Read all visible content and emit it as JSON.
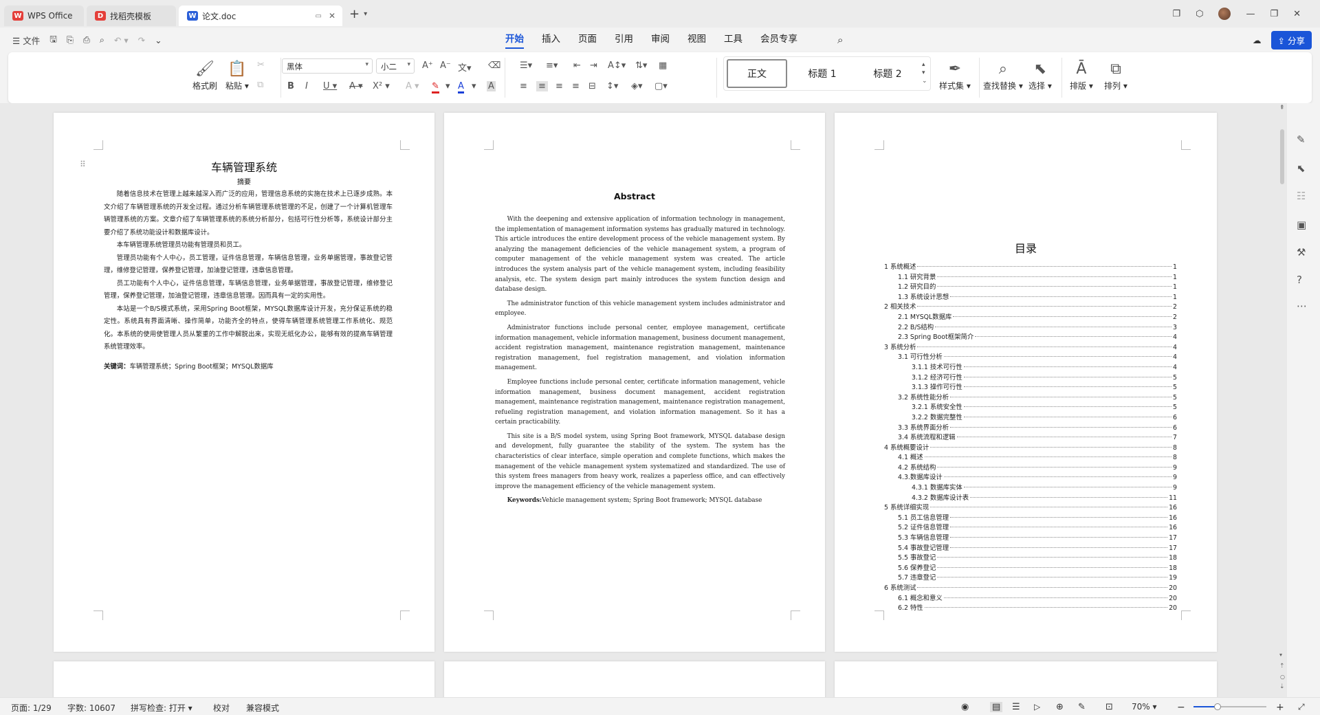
{
  "titlebar": {
    "tabs": [
      {
        "label": "WPS Office",
        "logo": "W",
        "color": "#e43f3a"
      },
      {
        "label": "找稻壳模板",
        "logo": "D",
        "color": "#e43f3a"
      },
      {
        "label": "论文.doc",
        "logo": "W",
        "color": "#2b5fd8"
      }
    ]
  },
  "menubar": {
    "file_label": "文件",
    "tabs": [
      "开始",
      "插入",
      "页面",
      "引用",
      "审阅",
      "视图",
      "工具",
      "会员专享"
    ],
    "active_tab": "开始",
    "share_label": "分享"
  },
  "ribbon": {
    "format_painter": "格式刷",
    "paste": "粘贴",
    "font_name": "黑体",
    "font_size": "小二",
    "styles": [
      "正文",
      "标题 1",
      "标题 2"
    ],
    "style_set": "样式集",
    "find_replace": "查找替换",
    "select": "选择",
    "layout": "排版",
    "arrange": "排列"
  },
  "page1": {
    "title": "车辆管理系统",
    "subtitle": "摘要",
    "paragraphs": [
      "随着信息技术在管理上越来越深入而广泛的应用，管理信息系统的实施在技术上已逐步成熟。本文介绍了车辆管理系统的开发全过程。通过分析车辆管理系统管理的不足，创建了一个计算机管理车辆管理系统的方案。文章介绍了车辆管理系统的系统分析部分，包括可行性分析等，系统设计部分主要介绍了系统功能设计和数据库设计。",
      "本车辆管理系统管理员功能有管理员和员工。",
      "管理员功能有个人中心，员工管理，证件信息管理，车辆信息管理，业务单据管理，事故登记管理，维修登记管理，保养登记管理，加油登记管理，违章信息管理。",
      "员工功能有个人中心，证件信息管理，车辆信息管理，业务单据管理，事故登记管理，维修登记管理，保养登记管理，加油登记管理，违章信息管理。因而具有一定的实用性。",
      "本站是一个B/S模式系统，采用Spring Boot框架，MYSQL数据库设计开发，充分保证系统的稳定性。系统具有界面清晰、操作简单，功能齐全的特点，使得车辆管理系统管理工作系统化、规范化。本系统的使用使管理人员从繁重的工作中解脱出来，实现无纸化办公，能够有效的提高车辆管理系统管理效率。"
    ],
    "keywords_label": "关键词：",
    "keywords": "车辆管理系统；Spring Boot框架；MYSQL数据库"
  },
  "page2": {
    "title": "Abstract",
    "paragraphs": [
      "With the deepening and extensive application of information technology in management, the implementation of management information systems has gradually matured in technology. This article introduces the entire development process of the vehicle management system. By analyzing the management deficiencies of the vehicle management system, a program of computer management of the vehicle management system was created. The article introduces the system analysis part of the vehicle management system, including feasibility analysis, etc. The system design part mainly introduces the system function design and database design.",
      "The administrator function of this vehicle management system includes administrator and employee.",
      "Administrator functions include personal center, employee management, certificate information management, vehicle information management, business document management, accident registration management, maintenance registration management, maintenance registration management, fuel registration management, and violation information management.",
      "Employee functions include personal center, certificate information management, vehicle information management, business document management, accident registration management, maintenance registration management, maintenance registration management, refueling registration management, and violation information management. So it has a certain practicability.",
      "This site is a B/S model system, using Spring Boot framework, MYSQL database design and development, fully guarantee the stability of the system. The system has the characteristics of clear interface, simple operation and complete functions, which makes the management of the vehicle management system systematized and standardized. The use of this system frees managers from heavy work, realizes a paperless office, and can effectively improve the management efficiency of the vehicle management system."
    ],
    "keywords_label": "Keywords:",
    "keywords": "Vehicle management system; Spring Boot framework; MYSQL database"
  },
  "page3": {
    "title": "目录",
    "toc": [
      {
        "label": "1 系统概述",
        "page": "1",
        "level": 0
      },
      {
        "label": "1.1 研究背景",
        "page": "1",
        "level": 1
      },
      {
        "label": "1.2 研究目的",
        "page": "1",
        "level": 1
      },
      {
        "label": "1.3 系统设计思想",
        "page": "1",
        "level": 1
      },
      {
        "label": "2 相关技术",
        "page": "2",
        "level": 0
      },
      {
        "label": "2.1 MYSQL数据库",
        "page": "2",
        "level": 1
      },
      {
        "label": "2.2 B/S结构",
        "page": "3",
        "level": 1
      },
      {
        "label": "2.3 Spring Boot框架简介",
        "page": "4",
        "level": 1
      },
      {
        "label": "3 系统分析",
        "page": "4",
        "level": 0
      },
      {
        "label": "3.1 可行性分析",
        "page": "4",
        "level": 1
      },
      {
        "label": "3.1.1 技术可行性",
        "page": "4",
        "level": 2
      },
      {
        "label": "3.1.2 经济可行性",
        "page": "5",
        "level": 2
      },
      {
        "label": "3.1.3 操作可行性",
        "page": "5",
        "level": 2
      },
      {
        "label": "3.2 系统性能分析",
        "page": "5",
        "level": 1
      },
      {
        "label": "3.2.1 系统安全性",
        "page": "5",
        "level": 2
      },
      {
        "label": "3.2.2 数据完整性",
        "page": "6",
        "level": 2
      },
      {
        "label": "3.3 系统界面分析",
        "page": "6",
        "level": 1
      },
      {
        "label": "3.4 系统流程和逻辑",
        "page": "7",
        "level": 1
      },
      {
        "label": "4 系统概要设计",
        "page": "8",
        "level": 0
      },
      {
        "label": "4.1 概述",
        "page": "8",
        "level": 1
      },
      {
        "label": "4.2 系统结构",
        "page": "9",
        "level": 1
      },
      {
        "label": "4.3.数据库设计",
        "page": "9",
        "level": 1
      },
      {
        "label": "4.3.1 数据库实体",
        "page": "9",
        "level": 2
      },
      {
        "label": "4.3.2 数据库设计表",
        "page": "11",
        "level": 2
      },
      {
        "label": "5 系统详细实现",
        "page": "16",
        "level": 0
      },
      {
        "label": "5.1 员工信息管理",
        "page": "16",
        "level": 1
      },
      {
        "label": "5.2 证件信息管理",
        "page": "16",
        "level": 1
      },
      {
        "label": "5.3 车辆信息管理",
        "page": "17",
        "level": 1
      },
      {
        "label": "5.4 事故登记管理",
        "page": "17",
        "level": 1
      },
      {
        "label": "5.5 事故登记",
        "page": "18",
        "level": 1
      },
      {
        "label": "5.6 保养登记",
        "page": "18",
        "level": 1
      },
      {
        "label": "5.7 违章登记",
        "page": "19",
        "level": 1
      },
      {
        "label": "6 系统测试",
        "page": "20",
        "level": 0
      },
      {
        "label": "6.1 概念和意义",
        "page": "20",
        "level": 1
      },
      {
        "label": "6.2 特性",
        "page": "20",
        "level": 1
      }
    ]
  },
  "status": {
    "page": "页面: 1/29",
    "words": "字数: 10607",
    "spell": "拼写检查: 打开",
    "proof": "校对",
    "compat": "兼容模式",
    "zoom": "70%"
  }
}
